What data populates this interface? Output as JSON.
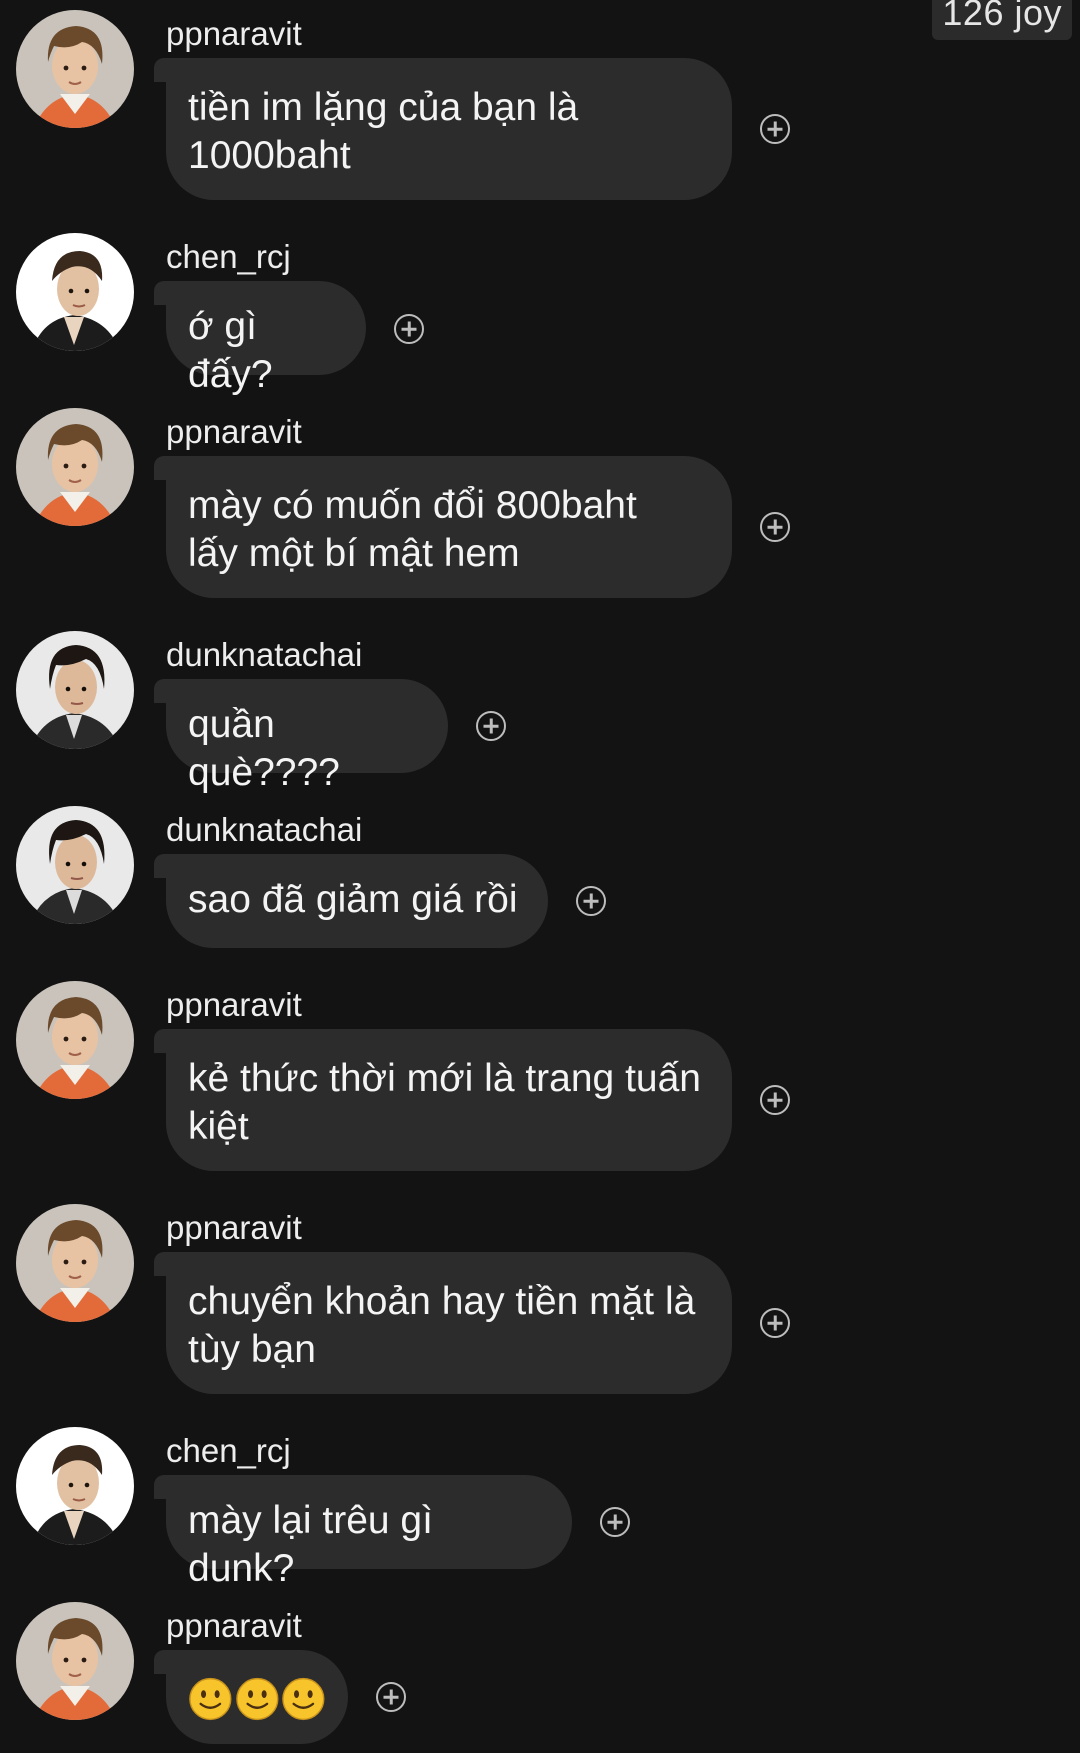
{
  "header": {
    "badge": "126 joy"
  },
  "messages": [
    {
      "user": "ppnaravit",
      "avatar": "avatar-ppnaravit",
      "text": "tiền im lặng của bạn là\n1000baht"
    },
    {
      "user": "chen_rcj",
      "avatar": "avatar-chen_rcj",
      "text": "ớ gì đấy?"
    },
    {
      "user": "ppnaravit",
      "avatar": "avatar-ppnaravit",
      "text": "mày có muốn đổi 800baht\nlấy một bí mật hem"
    },
    {
      "user": "dunknatachai",
      "avatar": "avatar-dunknatachai",
      "text": "quần què????"
    },
    {
      "user": "dunknatachai",
      "avatar": "avatar-dunknatachai",
      "text": "sao đã giảm giá rồi"
    },
    {
      "user": "ppnaravit",
      "avatar": "avatar-ppnaravit",
      "text": "kẻ thức thời mới là trang tuấn\nkiệt"
    },
    {
      "user": "ppnaravit",
      "avatar": "avatar-ppnaravit",
      "text": "chuyển khoản hay tiền mặt là\ntùy bạn"
    },
    {
      "user": "chen_rcj",
      "avatar": "avatar-chen_rcj",
      "text": "mày lại trêu gì dunk?"
    },
    {
      "user": "ppnaravit",
      "avatar": "avatar-ppnaravit",
      "text": "",
      "emoji": [
        "slightly-smiling-face",
        "slightly-smiling-face",
        "slightly-smiling-face"
      ]
    }
  ],
  "icons": {
    "reaction": "add-reaction-icon"
  },
  "colors": {
    "background": "#131313",
    "bubble": "#2c2c2c",
    "text": "#f4f4f4"
  }
}
